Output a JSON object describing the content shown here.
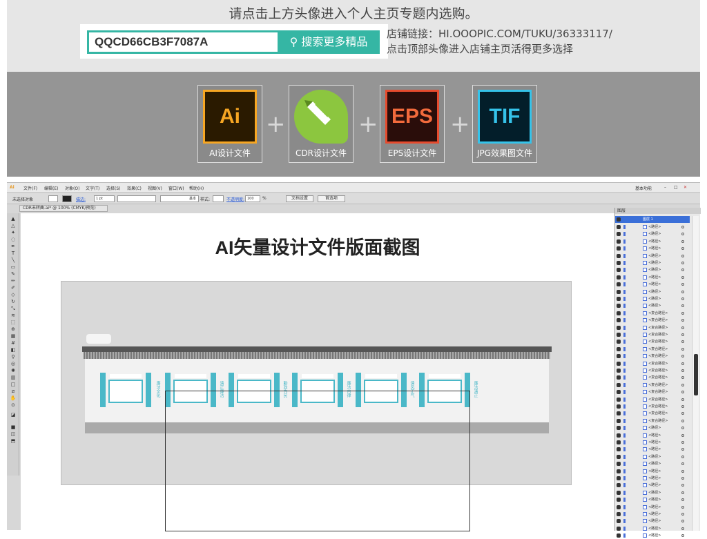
{
  "banner": {
    "title": "请点击上方头像进入个人主页专题内选购。",
    "search_value": "QQCD66CB3F7087A",
    "search_button": "搜索更多精品",
    "shop_link_label": "店铺链接：HI.OOOPIC.COM/TUKU/36333117/",
    "shop_hint": "点击顶部头像进入店铺主页活得更多选择"
  },
  "formats": [
    {
      "logo": "Ai",
      "caption": "AI设计文件"
    },
    {
      "logo": "CDR",
      "caption": "CDR设计文件"
    },
    {
      "logo": "EPS",
      "caption": "EPS设计文件"
    },
    {
      "logo": "TIF",
      "caption": "JPG效果图文件"
    }
  ],
  "plus": "+",
  "app": {
    "menu": [
      "文件(F)",
      "编辑(E)",
      "对象(O)",
      "文字(T)",
      "选择(S)",
      "效果(C)",
      "视图(V)",
      "窗口(W)",
      "帮助(H)"
    ],
    "workspace": "基本功能",
    "control": {
      "selection": "未选择对象",
      "stroke_label": "描边:",
      "stroke_value": "1 pt",
      "brush": "基本",
      "style_label": "样式:",
      "opacity_label": "不透明度:",
      "opacity_value": "100",
      "percent": "%",
      "doc_setup": "文档设置",
      "prefs": "首选项"
    },
    "doc_tab": "CDR未转曲.ai* @ 100% (CMYK/预览)",
    "canvas_title": "AI矢量设计文件版面截图",
    "wall_labels": [
      "廉洁文化",
      "清正廉洁",
      "勤政为民",
      "廉洁自律",
      "清风正气",
      "廉洁清正"
    ],
    "panel_title": "图层",
    "layer_top": "图层 1",
    "layers": [
      "<路径>",
      "<路径>",
      "<路径>",
      "<路径>",
      "<路径>",
      "<路径>",
      "<路径>",
      "<路径>",
      "<路径>",
      "<路径>",
      "<路径>",
      "<路径>",
      "<复合路径>",
      "<复合路径>",
      "<复合路径>",
      "<复合路径>",
      "<复合路径>",
      "<复合路径>",
      "<复合路径>",
      "<复合路径>",
      "<复合路径>",
      "<复合路径>",
      "<复合路径>",
      "<复合路径>",
      "<复合路径>",
      "<复合路径>",
      "<复合路径>",
      "<复合路径>",
      "<路径>",
      "<路径>",
      "<路径>",
      "<路径>",
      "<路径>",
      "<路径>",
      "<路径>",
      "<路径>",
      "<路径>",
      "<路径>",
      "<路径>",
      "<路径>",
      "<路径>",
      "<路径>",
      "<路径>",
      "<路径>"
    ]
  }
}
